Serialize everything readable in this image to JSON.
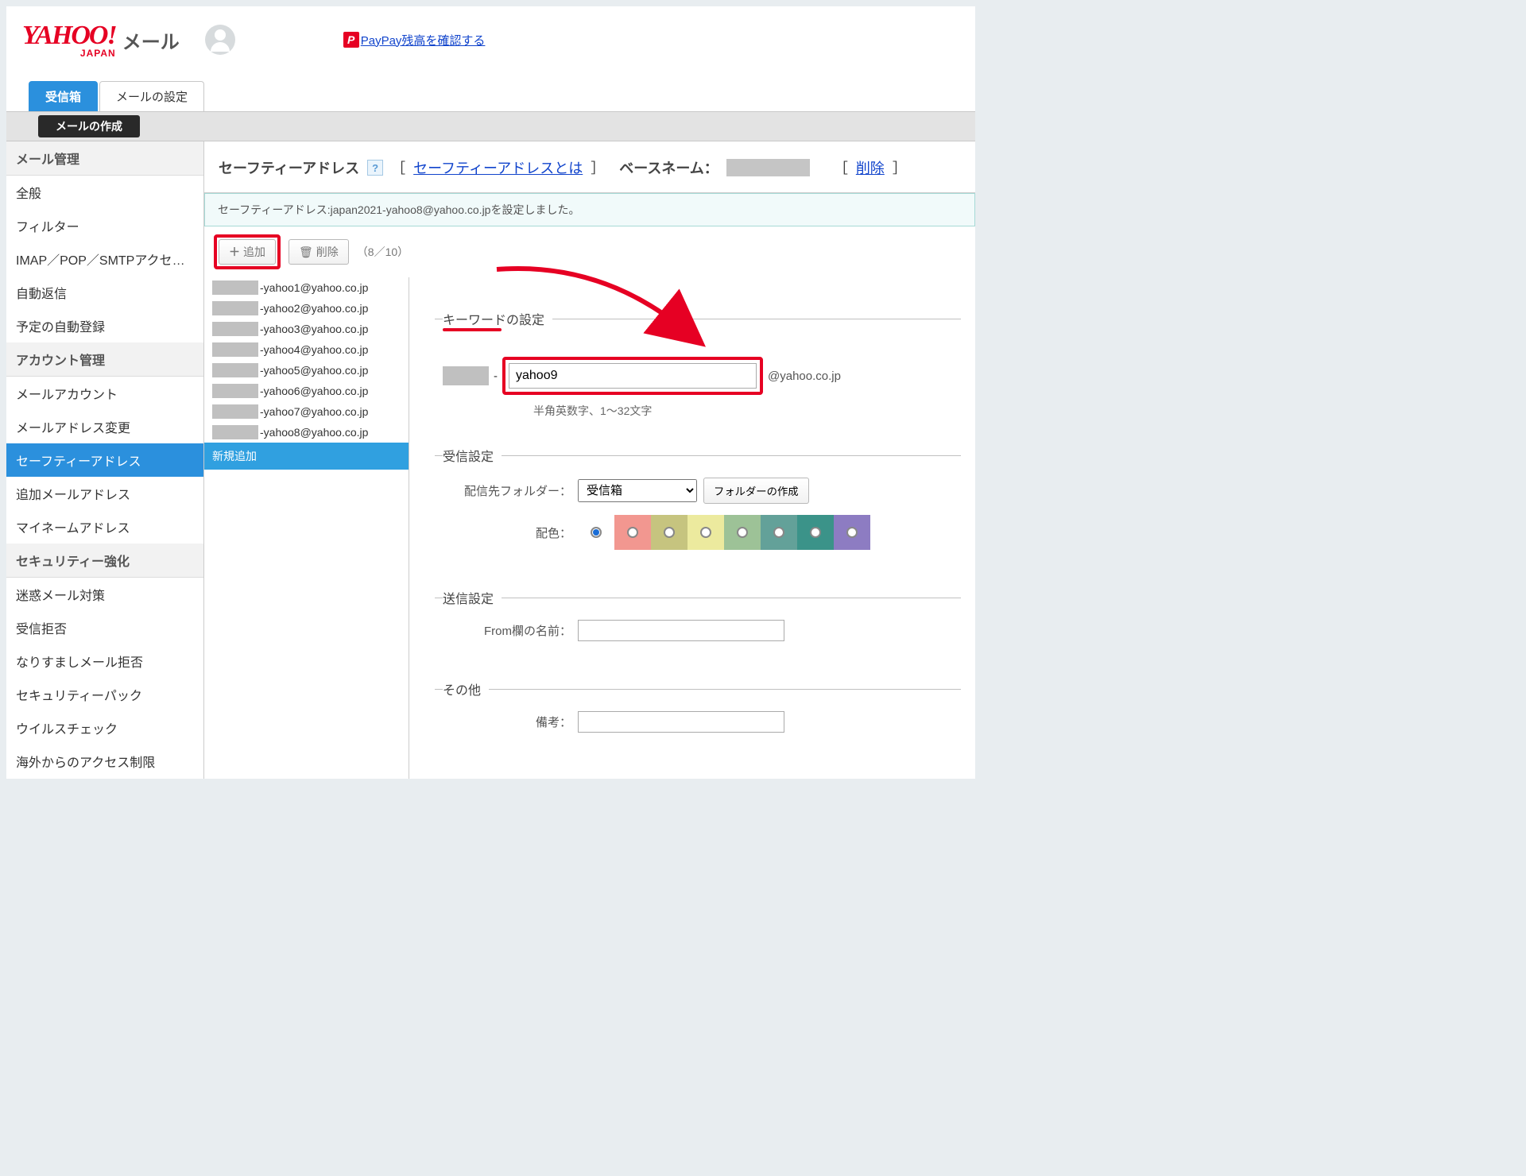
{
  "header": {
    "mail_label": "メール",
    "paypay_link": "PayPay残高を確認する",
    "paypay_icon_letter": "P"
  },
  "tabs": {
    "inbox": "受信箱",
    "settings": "メールの設定"
  },
  "compose": "メールの作成",
  "sidebar": {
    "mail_mgmt_hdr": "メール管理",
    "mail_mgmt": [
      "全般",
      "フィルター",
      "IMAP／POP／SMTPアクセスと…",
      "自動返信",
      "予定の自動登録"
    ],
    "acct_mgmt_hdr": "アカウント管理",
    "acct_mgmt": [
      "メールアカウント",
      "メールアドレス変更",
      "セーフティーアドレス",
      "追加メールアドレス",
      "マイネームアドレス"
    ],
    "sec_hdr": "セキュリティー強化",
    "sec": [
      "迷惑メール対策",
      "受信拒否",
      "なりすましメール拒否",
      "セキュリティーパック",
      "ウイルスチェック",
      "海外からのアクセス制限"
    ]
  },
  "sa": {
    "title": "セーフティーアドレス",
    "help": "?",
    "what_is": "セーフティーアドレスとは",
    "basename_label": "ベースネーム：",
    "delete": "削除",
    "flash": "セーフティーアドレス:japan2021-yahoo8@yahoo.co.jpを設定しました。",
    "add_label": "追加",
    "del_label": "削除",
    "counter": "（8／10）",
    "addresses": [
      "-yahoo1@yahoo.co.jp",
      "-yahoo2@yahoo.co.jp",
      "-yahoo3@yahoo.co.jp",
      "-yahoo4@yahoo.co.jp",
      "-yahoo5@yahoo.co.jp",
      "-yahoo6@yahoo.co.jp",
      "-yahoo7@yahoo.co.jp",
      "-yahoo8@yahoo.co.jp"
    ],
    "new_add": "新規追加"
  },
  "form": {
    "kw_legend": "キーワードの設定",
    "dash": "-",
    "kw_value": "yahoo9",
    "suffix": "@yahoo.co.jp",
    "kw_hint": "半角英数字、1～32文字",
    "recv_legend": "受信設定",
    "dest_label": "配信先フォルダー：",
    "dest_selected": "受信箱",
    "create_folder": "フォルダーの作成",
    "color_label": "配色：",
    "colors": [
      "#ffffff",
      "#f29790",
      "#c6c47f",
      "#ecea9e",
      "#9dc297",
      "#63a199",
      "#3b9389",
      "#8d7cc2"
    ],
    "send_legend": "送信設定",
    "from_label": "From欄の名前：",
    "other_legend": "その他",
    "note_label": "備考："
  }
}
